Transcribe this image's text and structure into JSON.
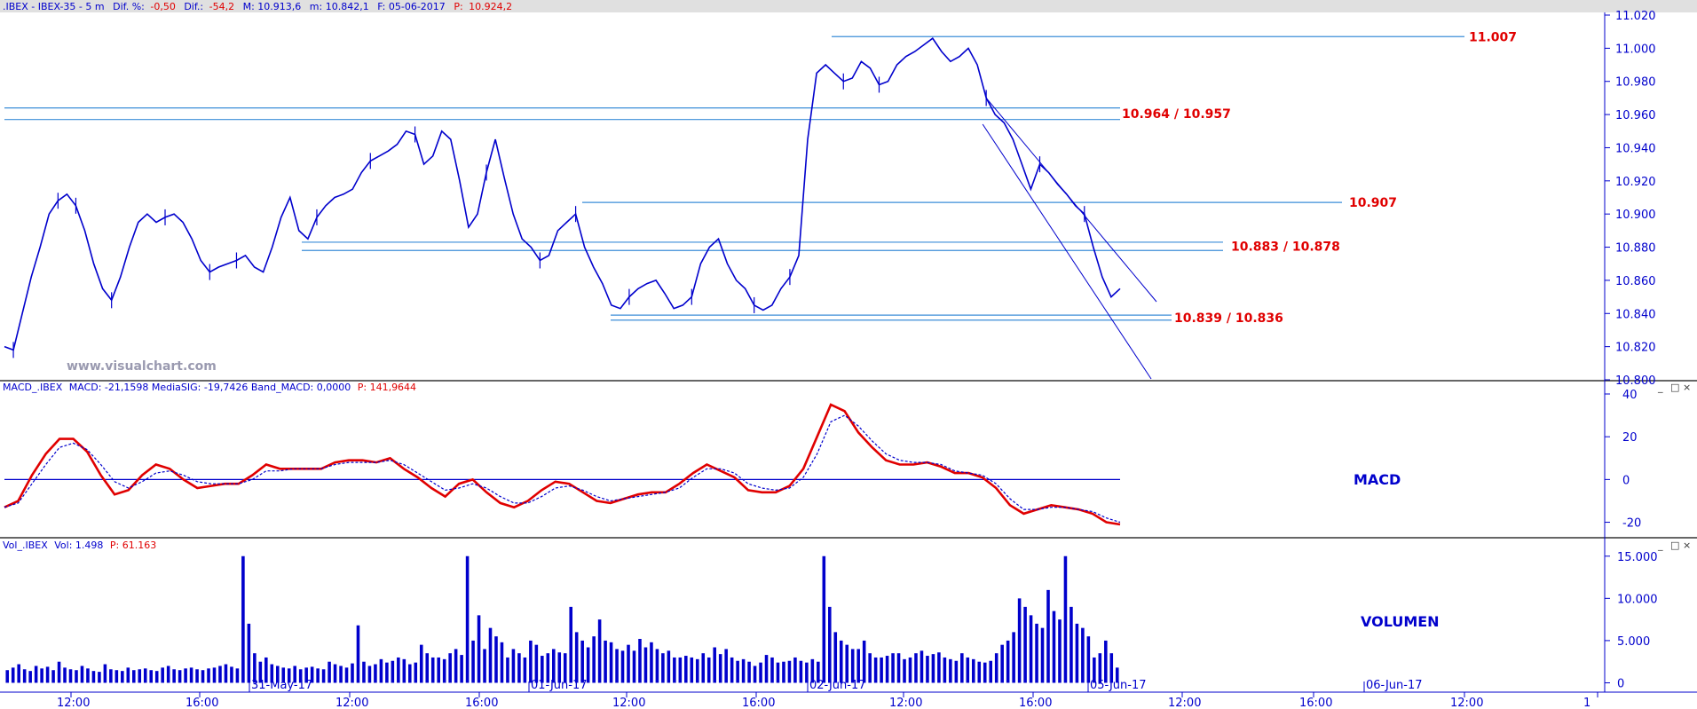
{
  "header": {
    "symbol": ".IBEX - IBEX-35 -  5 m",
    "dif_pct_label": "Dif. %:",
    "dif_pct": "-0,50",
    "dif_label": "Dif.:",
    "dif": "-54,2",
    "max": "M: 10.913,6",
    "min": "m: 10.842,1",
    "date": "F: 05-06-2017",
    "price_label": "P:",
    "price": "10.924,2"
  },
  "window_controls": [
    "_",
    "□",
    "×"
  ],
  "watermark": "www.visualchart.com",
  "macd_header": {
    "name": "MACD_.IBEX",
    "stats": "MACD: -21,1598  MediaSIG: -19,7426  Band_MACD: 0,0000",
    "price": "P: 141,9644"
  },
  "vol_header": {
    "name": "Vol_.IBEX",
    "stats": "Vol: 1.498",
    "price": "P: 61.163"
  },
  "colors": {
    "price": "#0000cc",
    "macd": "#e00000",
    "signal": "#0000cc",
    "level_text": "#e00000",
    "hline": "#3b8ed8"
  },
  "chart_data": [
    {
      "type": "line",
      "panel": "price",
      "ylim": [
        10800,
        11020
      ],
      "yticks": [
        "11.020",
        "11.000",
        "10.980",
        "10.960",
        "10.940",
        "10.920",
        "10.900",
        "10.880",
        "10.860",
        "10.840",
        "10.820",
        "10.800"
      ],
      "series": [
        {
          "values": [
            10820,
            10818,
            10840,
            10862,
            10880,
            10900,
            10908,
            10912,
            10905,
            10890,
            10870,
            10855,
            10848,
            10862,
            10880,
            10895,
            10900,
            10895,
            10898,
            10900,
            10895,
            10885,
            10872,
            10865,
            10868,
            10870,
            10872,
            10875,
            10868,
            10865,
            10880,
            10898,
            10910,
            10890,
            10885,
            10898,
            10905,
            10910,
            10912,
            10915,
            10925,
            10932,
            10935,
            10938,
            10942,
            10950,
            10948,
            10930,
            10935,
            10950,
            10945,
            10920,
            10892,
            10900,
            10925,
            10945,
            10922,
            10900,
            10885,
            10880,
            10872,
            10875,
            10890,
            10895,
            10900,
            10880,
            10868,
            10858,
            10845,
            10843,
            10850,
            10855,
            10858,
            10860,
            10852,
            10843,
            10845,
            10850,
            10870,
            10880,
            10885,
            10870,
            10860,
            10855,
            10845,
            10842,
            10845,
            10855,
            10862,
            10875,
            10945,
            10985,
            10990,
            10985,
            10980,
            10982,
            10992,
            10988,
            10978,
            10980,
            10990,
            10995,
            10998,
            11002,
            11006,
            10998,
            10992,
            10995,
            11000,
            10990,
            10970,
            10960,
            10955,
            10945,
            10930,
            10915,
            10930,
            10925,
            10918,
            10912,
            10905,
            10900,
            10880,
            10862,
            10850,
            10855
          ],
          "markers": [
            1,
            6,
            8,
            12,
            18,
            23,
            26,
            35,
            41,
            46,
            54,
            60,
            64,
            70,
            77,
            84,
            88,
            94,
            98,
            110,
            116,
            121
          ]
        }
      ],
      "levels": [
        {
          "value": "11.007",
          "label": "11.007"
        },
        {
          "value": "10.964 / 10.957",
          "label": "10.964 / 10.957"
        },
        {
          "value": "10.907",
          "label": "10.907"
        },
        {
          "value": "10.883 / 10.878",
          "label": "10.883 / 10.878"
        },
        {
          "value": "10.839 / 10.836",
          "label": "10.839 / 10.836"
        }
      ]
    },
    {
      "type": "line",
      "panel": "macd",
      "title": "MACD",
      "ylim": [
        -26,
        40
      ],
      "yticks": [
        "40",
        "20",
        "0",
        "-20"
      ],
      "series": [
        {
          "name": "MACD",
          "values": [
            -13,
            -10,
            2,
            12,
            19,
            19,
            13,
            2,
            -7,
            -5,
            2,
            7,
            5,
            0,
            -4,
            -3,
            -2,
            -2,
            2,
            7,
            5,
            5,
            5,
            5,
            8,
            9,
            9,
            8,
            10,
            5,
            1,
            -4,
            -8,
            -2,
            0,
            -6,
            -11,
            -13,
            -10,
            -5,
            -1,
            -2,
            -6,
            -10,
            -11,
            -9,
            -7,
            -6,
            -6,
            -2,
            3,
            7,
            4,
            1,
            -5,
            -6,
            -6,
            -3,
            5,
            20,
            35,
            32,
            22,
            15,
            9,
            7,
            7,
            8,
            6,
            3,
            3,
            1,
            -4,
            -12,
            -16,
            -14,
            -12,
            -13,
            -14,
            -16,
            -20,
            -21
          ]
        },
        {
          "name": "MediaSIG",
          "values": [
            -13,
            -11,
            -2,
            7,
            15,
            17,
            14,
            7,
            -1,
            -4,
            -1,
            3,
            4,
            2,
            -1,
            -2,
            -2,
            -2,
            0,
            4,
            4,
            5,
            5,
            5,
            7,
            8,
            8,
            8,
            9,
            7,
            3,
            -1,
            -5,
            -4,
            -2,
            -4,
            -8,
            -11,
            -11,
            -8,
            -4,
            -3,
            -5,
            -8,
            -10,
            -9,
            -8,
            -7,
            -6,
            -4,
            1,
            5,
            5,
            3,
            -2,
            -4,
            -5,
            -4,
            1,
            12,
            27,
            30,
            25,
            18,
            12,
            9,
            8,
            8,
            7,
            4,
            3,
            2,
            -2,
            -9,
            -14,
            -14,
            -13,
            -13,
            -14,
            -15,
            -18,
            -20
          ]
        }
      ]
    },
    {
      "type": "bar",
      "panel": "volume",
      "title": "VOLUMEN",
      "ylim": [
        -1000,
        15500
      ],
      "yticks": [
        "15.000",
        "10.000",
        "5.000",
        "0"
      ],
      "values": [
        1500,
        1800,
        2200,
        1600,
        1400,
        2000,
        1700,
        1900,
        1500,
        2500,
        1800,
        1600,
        1500,
        2000,
        1700,
        1400,
        1300,
        2200,
        1600,
        1500,
        1400,
        1800,
        1500,
        1600,
        1700,
        1500,
        1400,
        1800,
        2000,
        1600,
        1500,
        1700,
        1800,
        1600,
        1500,
        1700,
        1800,
        2000,
        2200,
        1900,
        1700,
        15000,
        7000,
        3500,
        2500,
        3000,
        2200,
        2000,
        1800,
        1700,
        2000,
        1600,
        1800,
        1900,
        1700,
        1600,
        2500,
        2200,
        2000,
        1800,
        2300,
        6800,
        2500,
        2000,
        2200,
        2800,
        2400,
        2600,
        3000,
        2800,
        2200,
        2400,
        4500,
        3500,
        3000,
        3000,
        2800,
        3500,
        4000,
        3300,
        15000,
        5000,
        8000,
        4000,
        6500,
        5500,
        4800,
        3000,
        4000,
        3500,
        3000,
        5000,
        4500,
        3200,
        3500,
        4000,
        3600,
        3500,
        9000,
        6000,
        5000,
        4200,
        5500,
        7500,
        5000,
        4800,
        4000,
        3800,
        4500,
        3800,
        5200,
        4200,
        4800,
        4000,
        3500,
        3800,
        3000,
        3000,
        3200,
        3000,
        2800,
        3500,
        3000,
        4200,
        3400,
        4000,
        3000,
        2600,
        2800,
        2500,
        2000,
        2400,
        3300,
        3000,
        2400,
        2500,
        2600,
        3000,
        2600,
        2400,
        2800,
        2500,
        15000,
        9000,
        6000,
        5000,
        4500,
        4000,
        4000,
        5000,
        3500,
        3000,
        3000,
        3200,
        3500,
        3500,
        2800,
        3000,
        3500,
        3800,
        3200,
        3400,
        3600,
        3000,
        2800,
        2600,
        3500,
        3000,
        2800,
        2500,
        2400,
        2600,
        3500,
        4500,
        5000,
        6000,
        10000,
        9000,
        8000,
        7000,
        6500,
        11000,
        8500,
        7500,
        15000,
        9000,
        7000,
        6500,
        5500,
        3000,
        3500,
        5000,
        3500,
        1800
      ]
    }
  ],
  "x_axis": {
    "time_ticks": [
      "12:00",
      "16:00",
      "12:00",
      "16:00",
      "12:00",
      "16:00",
      "12:00",
      "16:00",
      "12:00",
      "16:00",
      "12:00",
      "1"
    ],
    "date_ticks": [
      "31-May-17",
      "01-Jun-17",
      "02-Jun-17",
      "05-Jun-17",
      "06-Jun-17"
    ]
  }
}
